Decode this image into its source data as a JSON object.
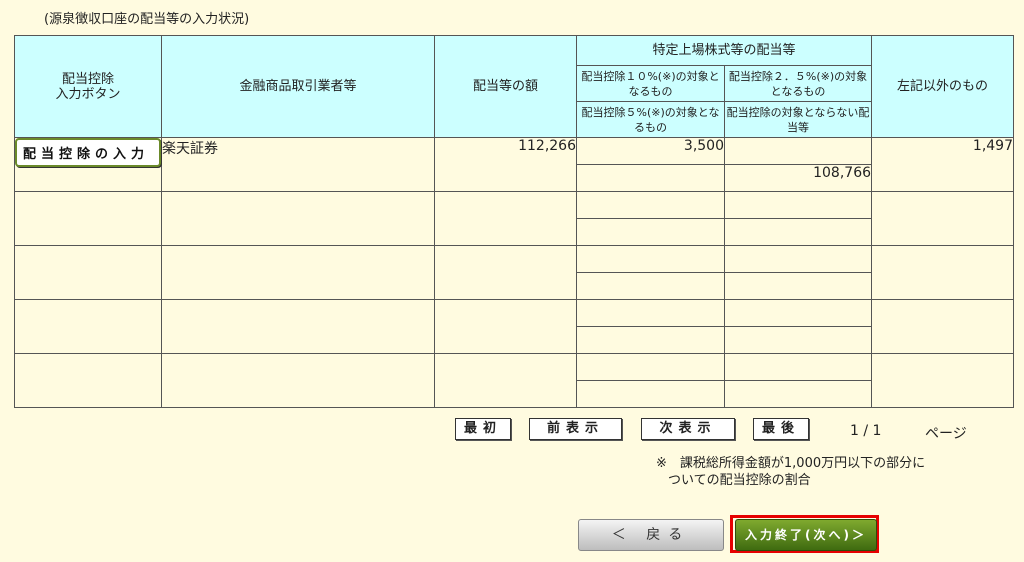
{
  "section_title": "(源泉徴収口座の配当等の入力状況)",
  "headers": {
    "input_button": "配当控除\n入力ボタン",
    "broker": "金融商品取引業者等",
    "dividend_amount": "配当等の額",
    "listed_group": "特定上場株式等の配当等",
    "sub_10pct": "配当控除１０%(※)の対象となるもの",
    "sub_2_5pct": "配当控除２．５%(※)の対象となるもの",
    "sub_5pct": "配当控除５%(※)の対象となるもの",
    "sub_none": "配当控除の対象とならない配当等",
    "other": "左記以外のもの"
  },
  "rows": [
    {
      "button": "配当控除の入力",
      "broker": "楽天証券",
      "amount": "112,266",
      "d10": "3,500",
      "d2_5": "",
      "d5": "",
      "dnone": "108,766",
      "other": "1,497"
    },
    {
      "button": "",
      "broker": "",
      "amount": "",
      "d10": "",
      "d2_5": "",
      "d5": "",
      "dnone": "",
      "other": ""
    },
    {
      "button": "",
      "broker": "",
      "amount": "",
      "d10": "",
      "d2_5": "",
      "d5": "",
      "dnone": "",
      "other": ""
    },
    {
      "button": "",
      "broker": "",
      "amount": "",
      "d10": "",
      "d2_5": "",
      "d5": "",
      "dnone": "",
      "other": ""
    },
    {
      "button": "",
      "broker": "",
      "amount": "",
      "d10": "",
      "d2_5": "",
      "d5": "",
      "dnone": "",
      "other": ""
    }
  ],
  "pager": {
    "first": "最初",
    "prev": "前表示",
    "next": "次表示",
    "last": "最後",
    "page": "1 / 1",
    "page_word": "ページ"
  },
  "note": {
    "line1": "※　課税総所得金額が1,000万円以下の部分に",
    "line2": "ついての配当控除の割合"
  },
  "footer": {
    "back": "＜ 戻る",
    "next": "入力終了(次へ)＞"
  },
  "colors": {
    "background": "#fffbe0",
    "header_bg": "#ccffff",
    "next_button": "#5a8a1e",
    "highlight_frame": "#e60000"
  }
}
